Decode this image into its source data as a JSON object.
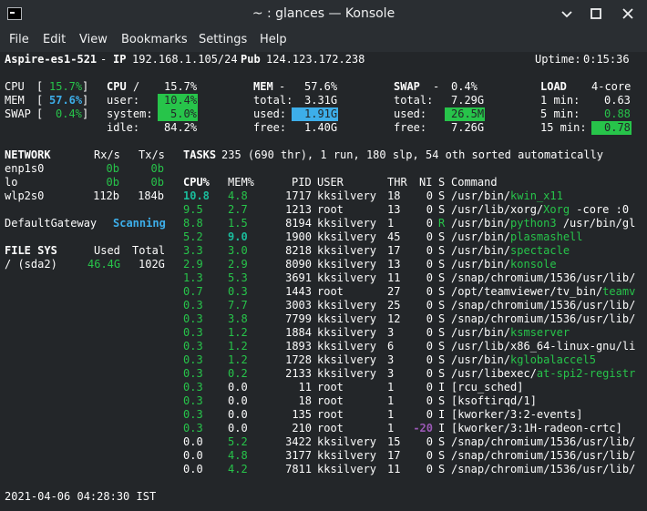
{
  "window": {
    "title": "~ : glances — Konsole"
  },
  "menu": [
    "File",
    "Edit",
    "View",
    "Bookmarks",
    "Settings",
    "Help"
  ],
  "header": {
    "host": "Aspire-es1-521",
    "ip_label": "IP",
    "ip": "192.168.1.105/24",
    "pub_label": "Pub",
    "pub": "124.123.172.238",
    "uptime_label": "Uptime:",
    "uptime": "0:15:36"
  },
  "quicklook": {
    "cpu_label": "CPU",
    "cpu_val": "15.7%",
    "mem_label": "MEM",
    "mem_val": "57.6%",
    "swap_label": "SWAP",
    "swap_val": "0.4%"
  },
  "cpu": {
    "label": "CPU",
    "sep": "/",
    "total": "15.7%",
    "rows": [
      {
        "label": "user:",
        "value": "10.4%"
      },
      {
        "label": "system:",
        "value": "5.0%"
      },
      {
        "label": "idle:",
        "value": "84.2%"
      }
    ]
  },
  "mem": {
    "label": "MEM",
    "sep": "-",
    "total": "57.6%",
    "rows": [
      {
        "label": "total:",
        "value": "3.31G"
      },
      {
        "label": "used:",
        "value": "1.91G"
      },
      {
        "label": "free:",
        "value": "1.40G"
      }
    ]
  },
  "swap": {
    "label": "SWAP",
    "sep": "-",
    "total": "0.4%",
    "rows": [
      {
        "label": "total:",
        "value": "7.29G"
      },
      {
        "label": "used:",
        "value": "26.5M"
      },
      {
        "label": "free:",
        "value": "7.26G"
      }
    ]
  },
  "load": {
    "label": "LOAD",
    "cores": "4-core",
    "rows": [
      {
        "label": "1 min:",
        "value": "0.63"
      },
      {
        "label": "5 min:",
        "value": "0.88"
      },
      {
        "label": "15 min:",
        "value": "0.78"
      }
    ]
  },
  "network": {
    "label": "NETWORK",
    "rx_label": "Rx/s",
    "tx_label": "Tx/s",
    "rows": [
      {
        "iface": "enp1s0",
        "rx": "0b",
        "tx": "0b"
      },
      {
        "iface": "lo",
        "rx": "0b",
        "tx": "0b"
      },
      {
        "iface": "wlp2s0",
        "rx": "112b",
        "tx": "184b"
      }
    ]
  },
  "gateway": {
    "label": "DefaultGateway",
    "status": "Scanning"
  },
  "filesys": {
    "label": "FILE SYS",
    "used_label": "Used",
    "total_label": "Total",
    "rows": [
      {
        "mount": "/ (sda2)",
        "used": "46.4G",
        "total": "102G"
      }
    ]
  },
  "tasks": {
    "label": "TASKS",
    "summary": "235 (690 thr), 1 run, 180 slp, 54 oth sorted automatically"
  },
  "proc_headers": {
    "cpu": "CPU%",
    "mem": "MEM%",
    "pid": "PID",
    "user": "USER",
    "thr": "THR",
    "ni": "NI",
    "s": "S",
    "command": "Command"
  },
  "processes": [
    {
      "cpu": "10.8",
      "mem": "4.8",
      "pid": "1717",
      "user": "kksilvery",
      "thr": "18",
      "ni": "0",
      "s": "S",
      "cmd_pre": "/usr/bin/",
      "cmd_hl": "kwin_x11",
      "cmd_post": ""
    },
    {
      "cpu": "9.5",
      "mem": "2.7",
      "pid": "1213",
      "user": "root",
      "thr": "13",
      "ni": "0",
      "s": "S",
      "cmd_pre": "/usr/lib/xorg/",
      "cmd_hl": "Xorg",
      "cmd_post": " -core :0"
    },
    {
      "cpu": "8.8",
      "mem": "1.5",
      "pid": "8194",
      "user": "kksilvery",
      "thr": "1",
      "ni": "0",
      "s": "R",
      "cmd_pre": "/usr/bin/",
      "cmd_hl": "python3",
      "cmd_post": " /usr/bin/gl"
    },
    {
      "cpu": "5.2",
      "mem": "9.0",
      "pid": "1900",
      "user": "kksilvery",
      "thr": "45",
      "ni": "0",
      "s": "S",
      "cmd_pre": "/usr/bin/",
      "cmd_hl": "plasmashell",
      "cmd_post": ""
    },
    {
      "cpu": "3.3",
      "mem": "3.0",
      "pid": "8218",
      "user": "kksilvery",
      "thr": "17",
      "ni": "0",
      "s": "S",
      "cmd_pre": "/usr/bin/",
      "cmd_hl": "spectacle",
      "cmd_post": ""
    },
    {
      "cpu": "2.9",
      "mem": "2.9",
      "pid": "8090",
      "user": "kksilvery",
      "thr": "13",
      "ni": "0",
      "s": "S",
      "cmd_pre": "/usr/bin/",
      "cmd_hl": "konsole",
      "cmd_post": ""
    },
    {
      "cpu": "1.3",
      "mem": "5.3",
      "pid": "3691",
      "user": "kksilvery",
      "thr": "11",
      "ni": "0",
      "s": "S",
      "cmd_pre": "/snap/chromium/1536/usr/lib/",
      "cmd_hl": "",
      "cmd_post": ""
    },
    {
      "cpu": "0.7",
      "mem": "0.3",
      "pid": "1443",
      "user": "root",
      "thr": "27",
      "ni": "0",
      "s": "S",
      "cmd_pre": "/opt/teamviewer/tv_bin/",
      "cmd_hl": "teamv",
      "cmd_post": ""
    },
    {
      "cpu": "0.3",
      "mem": "7.7",
      "pid": "3003",
      "user": "kksilvery",
      "thr": "25",
      "ni": "0",
      "s": "S",
      "cmd_pre": "/snap/chromium/1536/usr/lib/",
      "cmd_hl": "",
      "cmd_post": ""
    },
    {
      "cpu": "0.3",
      "mem": "3.8",
      "pid": "7799",
      "user": "kksilvery",
      "thr": "12",
      "ni": "0",
      "s": "S",
      "cmd_pre": "/snap/chromium/1536/usr/lib/",
      "cmd_hl": "",
      "cmd_post": ""
    },
    {
      "cpu": "0.3",
      "mem": "1.2",
      "pid": "1884",
      "user": "kksilvery",
      "thr": "3",
      "ni": "0",
      "s": "S",
      "cmd_pre": "/usr/bin/",
      "cmd_hl": "ksmserver",
      "cmd_post": ""
    },
    {
      "cpu": "0.3",
      "mem": "1.2",
      "pid": "1893",
      "user": "kksilvery",
      "thr": "6",
      "ni": "0",
      "s": "S",
      "cmd_pre": "/usr/lib/x86_64-linux-gnu/li",
      "cmd_hl": "",
      "cmd_post": ""
    },
    {
      "cpu": "0.3",
      "mem": "1.2",
      "pid": "1728",
      "user": "kksilvery",
      "thr": "3",
      "ni": "0",
      "s": "S",
      "cmd_pre": "/usr/bin/",
      "cmd_hl": "kglobalaccel5",
      "cmd_post": ""
    },
    {
      "cpu": "0.3",
      "mem": "0.2",
      "pid": "2133",
      "user": "kksilvery",
      "thr": "3",
      "ni": "0",
      "s": "S",
      "cmd_pre": "/usr/libexec/",
      "cmd_hl": "at-spi2-registr",
      "cmd_post": ""
    },
    {
      "cpu": "0.3",
      "mem": "0.0",
      "pid": "11",
      "user": "root",
      "thr": "1",
      "ni": "0",
      "s": "I",
      "cmd_pre": "[rcu_sched]",
      "cmd_hl": "",
      "cmd_post": ""
    },
    {
      "cpu": "0.3",
      "mem": "0.0",
      "pid": "18",
      "user": "root",
      "thr": "1",
      "ni": "0",
      "s": "S",
      "cmd_pre": "[ksoftirqd/1]",
      "cmd_hl": "",
      "cmd_post": ""
    },
    {
      "cpu": "0.3",
      "mem": "0.0",
      "pid": "135",
      "user": "root",
      "thr": "1",
      "ni": "0",
      "s": "I",
      "cmd_pre": "[kworker/3:2-events]",
      "cmd_hl": "",
      "cmd_post": ""
    },
    {
      "cpu": "0.3",
      "mem": "0.0",
      "pid": "210",
      "user": "root",
      "thr": "1",
      "ni": "-20",
      "s": "I",
      "cmd_pre": "[kworker/3:1H-radeon-crtc]",
      "cmd_hl": "",
      "cmd_post": ""
    },
    {
      "cpu": "0.0",
      "mem": "5.2",
      "pid": "3422",
      "user": "kksilvery",
      "thr": "15",
      "ni": "0",
      "s": "S",
      "cmd_pre": "/snap/chromium/1536/usr/lib/",
      "cmd_hl": "",
      "cmd_post": ""
    },
    {
      "cpu": "0.0",
      "mem": "4.8",
      "pid": "3177",
      "user": "kksilvery",
      "thr": "17",
      "ni": "0",
      "s": "S",
      "cmd_pre": "/snap/chromium/1536/usr/lib/",
      "cmd_hl": "",
      "cmd_post": ""
    },
    {
      "cpu": "0.0",
      "mem": "4.2",
      "pid": "7811",
      "user": "kksilvery",
      "thr": "11",
      "ni": "0",
      "s": "S",
      "cmd_pre": "/snap/chromium/1536/usr/lib/",
      "cmd_hl": "",
      "cmd_post": ""
    }
  ],
  "footer": {
    "datetime": "2021-04-06 04:28:30 IST"
  },
  "colors": {
    "background": "#232629",
    "titlebar": "#2a2e32",
    "ok_green": "#27c44a",
    "careful_blue": "#3daee9",
    "nice_purple": "#9b59b6",
    "teal": "#1abc9c"
  },
  "icons": [
    "terminal-icon",
    "chevron-down-icon",
    "minimize-icon",
    "maximize-icon",
    "close-icon"
  ]
}
